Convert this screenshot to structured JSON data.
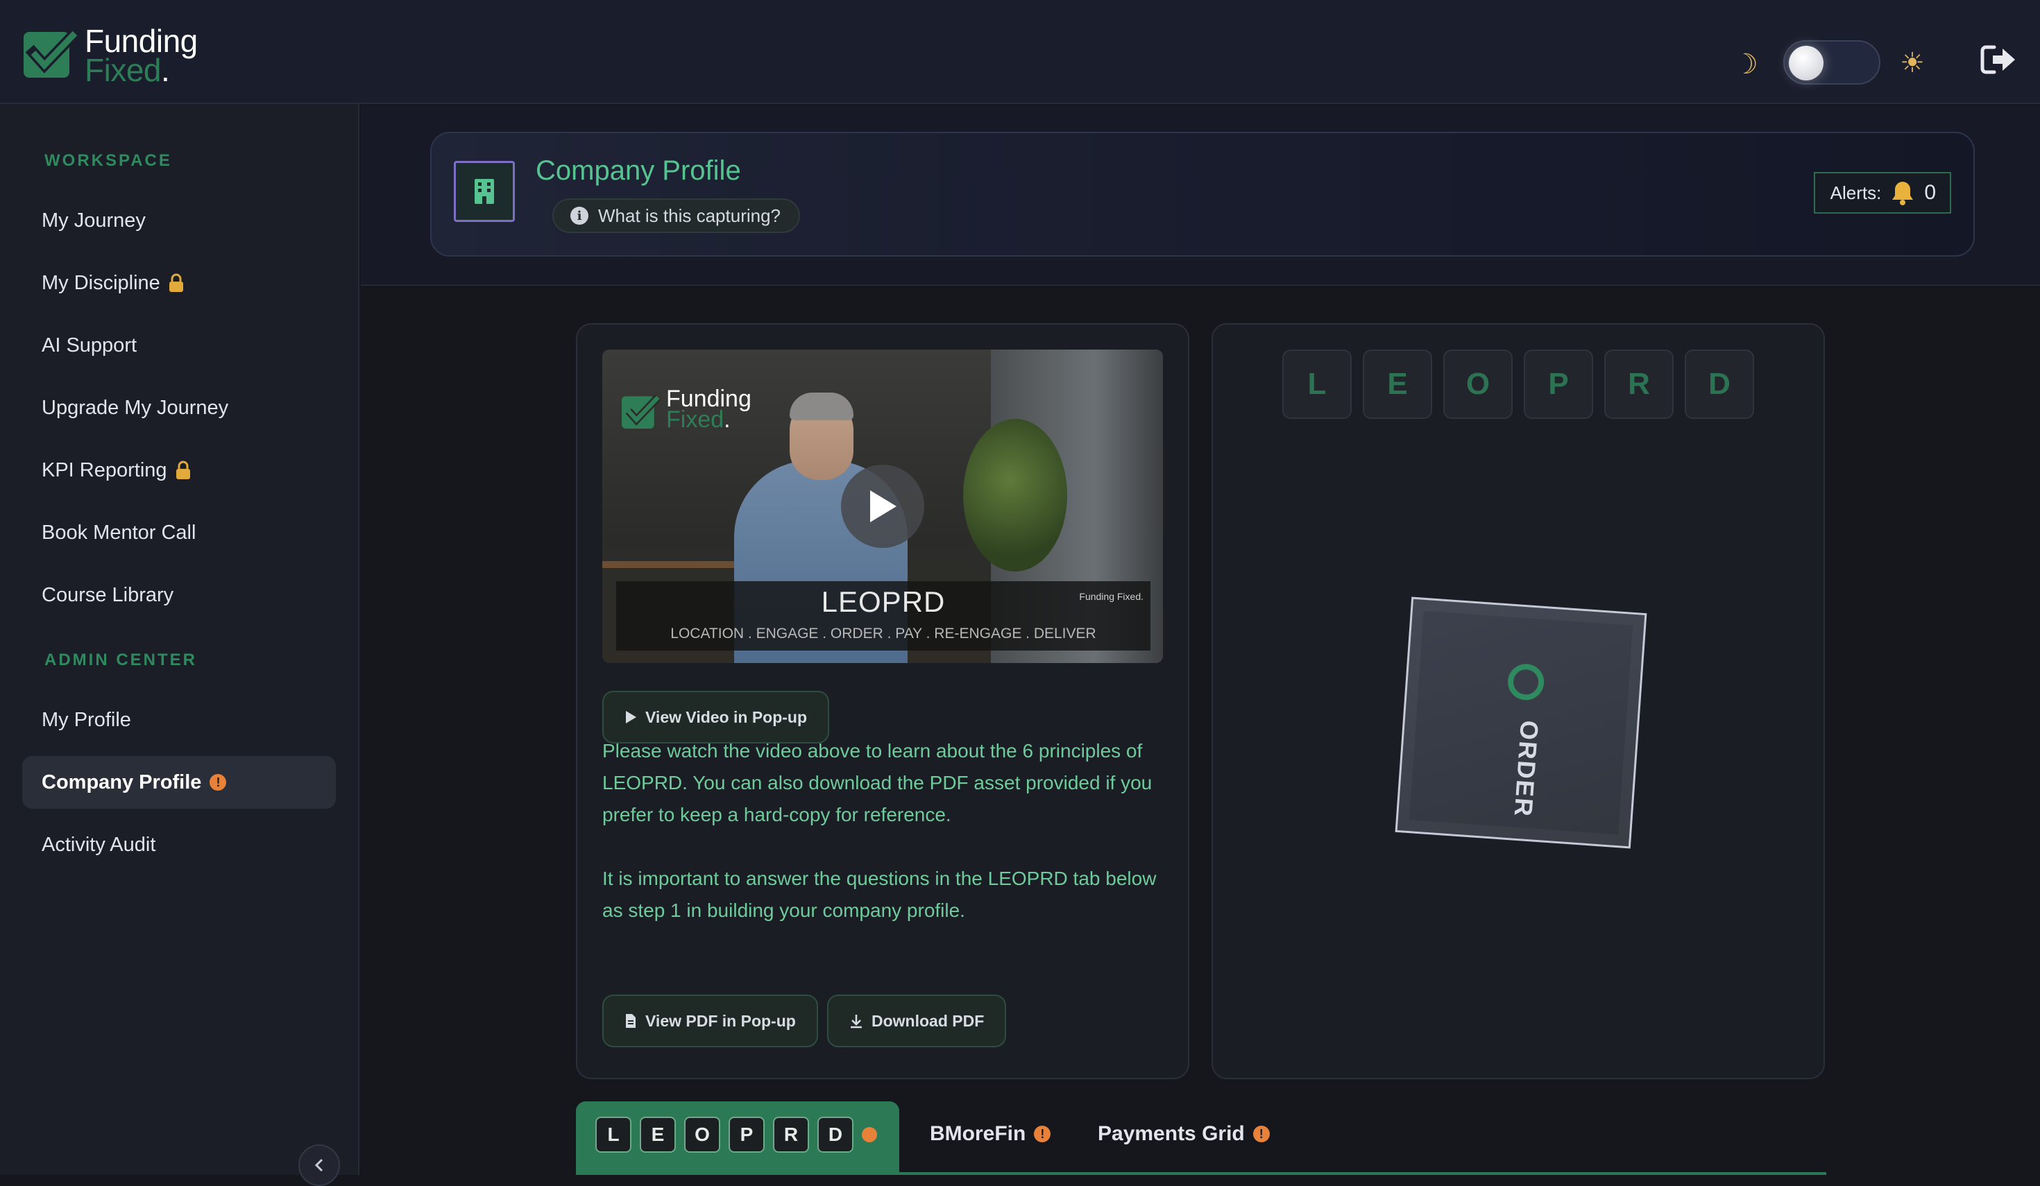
{
  "brand": {
    "word1": "Funding",
    "word2": "Fixed",
    "dot": ".",
    "color_primary": "#2d7d57"
  },
  "header": {
    "theme_toggle_state": "dark"
  },
  "sidebar": {
    "sections": [
      {
        "title": "WORKSPACE"
      },
      {
        "title": "ADMIN CENTER"
      }
    ],
    "workspace_items": [
      {
        "label": "My Journey"
      },
      {
        "label": "My Discipline",
        "locked": true
      },
      {
        "label": "AI Support"
      },
      {
        "label": "Upgrade My Journey"
      },
      {
        "label": "KPI Reporting",
        "locked": true
      },
      {
        "label": "Book Mentor Call"
      },
      {
        "label": "Course Library"
      }
    ],
    "admin_items": [
      {
        "label": "My Profile"
      },
      {
        "label": "Company Profile",
        "active": true,
        "warning": "!"
      },
      {
        "label": "Activity Audit"
      }
    ],
    "collapse_icon": "chevron-left-icon"
  },
  "profile": {
    "title": "Company Profile",
    "capture_pill": "What is this capturing?",
    "alerts_label": "Alerts:",
    "alerts_count": "0"
  },
  "video": {
    "logo_word1": "Funding",
    "logo_word2": "Fixed",
    "logo_dot": ".",
    "title": "LEOPRD",
    "subtitle": "LOCATION . ENGAGE . ORDER . PAY . RE-ENGAGE . DELIVER",
    "corner_logo": "Funding Fixed.",
    "popup_button": "View Video in Pop-up",
    "paragraph1": "Please watch the video above to learn about the 6 principles of LEOPRD. You can also download the PDF asset provided if you prefer to keep a hard-copy for reference.",
    "paragraph2": "It is important to answer the questions in the LEOPRD tab below as step 1 in building your company profile.",
    "pdf_popup_button": "View PDF in Pop-up",
    "download_button": "Download PDF"
  },
  "leoprd": {
    "letters": [
      "L",
      "E",
      "O",
      "P",
      "R",
      "D"
    ],
    "cube_label": "ORDER"
  },
  "tabs": {
    "letters": [
      "L",
      "E",
      "O",
      "P",
      "R",
      "D"
    ],
    "bmorefin": "BMoreFin",
    "payments_grid": "Payments Grid",
    "warning": "!"
  }
}
